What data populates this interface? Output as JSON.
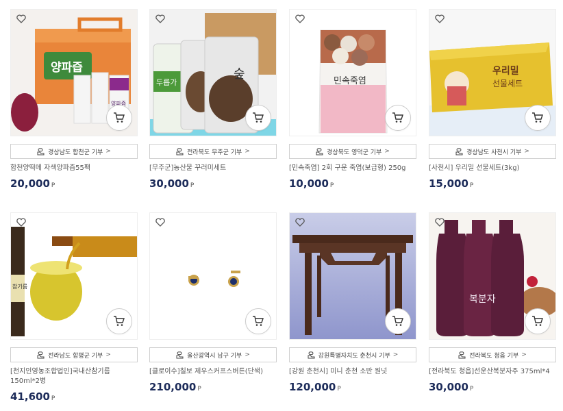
{
  "products": [
    {
      "region": "경상남도 합천군 기부",
      "name": "합천양떡메 자색양파즙55팩",
      "price": "20,000",
      "currency": "P"
    },
    {
      "region": "전라북도 무주군 기부",
      "name": "[무주군]농산물 꾸러미세트",
      "price": "30,000",
      "currency": "P"
    },
    {
      "region": "경상북도 영덕군 기부",
      "name": "[민속죽염] 2회 구운 죽염(보급형) 250g",
      "price": "10,000",
      "currency": "P"
    },
    {
      "region": "경상남도 사천시 기부",
      "name": "[사천시] 우리밀 선물세트(3kg)",
      "price": "15,000",
      "currency": "P"
    },
    {
      "region": "전라남도 함평군 기부",
      "name": "[천지인영농조합법인]국내산참기름150ml*2병",
      "price": "41,600",
      "currency": "P"
    },
    {
      "region": "울산광역시 남구 기부",
      "name": "[클로이수]칠보 제우스커프스버튼(단색)",
      "price": "210,000",
      "currency": "P"
    },
    {
      "region": "강원특별자치도 춘천시 기부",
      "name": "[강원 춘천시] 미니 춘천 소반 원넛",
      "price": "120,000",
      "currency": "P"
    },
    {
      "region": "전라북도 청읍 기부",
      "name": "[전라북도 청읍]선운산복분자주 375ml*4",
      "price": "30,000",
      "currency": "P"
    }
  ],
  "image_labels": {
    "onion_box": "양파즙",
    "onion_pouch": "양파즙",
    "bag_label": "두릅가",
    "bag_label2": "숲",
    "salt_label": "민속죽염",
    "wheat_label": "우리밀",
    "wheat_label2": "선물세트",
    "oil_label": "참기름",
    "wine_label": "복분자"
  },
  "colors": {
    "price": "#1d2c5a",
    "border": "#cfcfcf"
  }
}
